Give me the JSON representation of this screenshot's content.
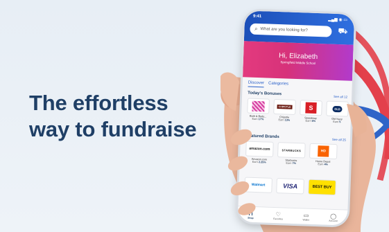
{
  "headline": {
    "line1": "The effortless",
    "line2": "way to fundraise"
  },
  "colors": {
    "navy": "#1f3f66",
    "red_ribbon": "#e3404b",
    "blue_ribbon": "#2e64c8",
    "banner_pink": "#e33a7e"
  },
  "phone": {
    "status_time": "9:41",
    "status_icons": "signal-wifi-battery",
    "search_placeholder": "What are you looking for?",
    "greeting": "Hi, Elizabeth",
    "school": "Springfield Middle School",
    "tabs": [
      "Discover",
      "Categories"
    ],
    "bonuses": {
      "title": "Today's Bonuses",
      "see_all": "See all 12",
      "items": [
        {
          "logo": "",
          "name": "Bath & Body...",
          "earn": "17%"
        },
        {
          "logo": "CHIPOTLE",
          "name": "Chipotle",
          "earn": "13%"
        },
        {
          "logo": "S",
          "name": "Speedway",
          "earn": "6%"
        },
        {
          "logo": "OLD",
          "name": "Old Navy",
          "earn": "5"
        }
      ]
    },
    "brands": {
      "title": "Featured Brands",
      "see_all": "See all 25",
      "items": [
        {
          "logo": "amazon.com",
          "name": "Amazon.com",
          "earn": "2.25%"
        },
        {
          "logo": "STARBUCKS",
          "name": "Starbucks",
          "earn": "7%"
        },
        {
          "logo": "HD",
          "name": "Home Depot",
          "earn": "4%"
        }
      ],
      "row2": [
        "Walmart",
        "VISA",
        "BEST BUY"
      ]
    },
    "nav": [
      "Shop",
      "Favorites",
      "Wallet",
      "Account"
    ],
    "earn_prefix": "Earn"
  }
}
